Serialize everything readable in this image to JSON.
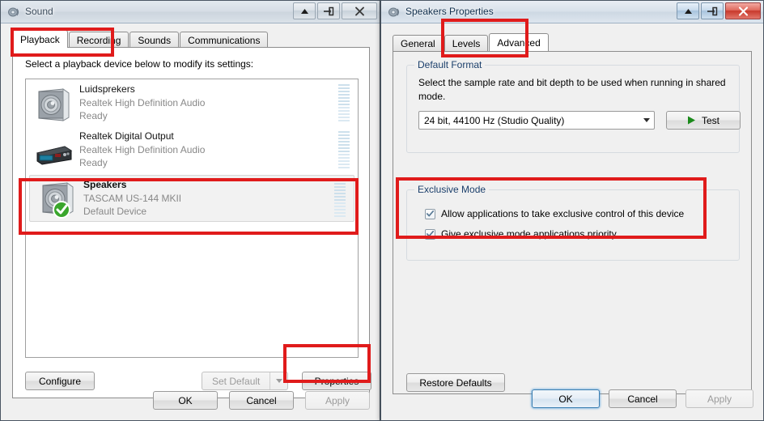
{
  "backdrop": {
    "ghost_text": "exclusive mode"
  },
  "sound_window": {
    "title": "Sound",
    "icon": "speaker-icon",
    "window_buttons": [
      {
        "name": "minimize-button",
        "glyph": "up-arrow-icon"
      },
      {
        "name": "maximize-button",
        "glyph": "pin-icon"
      },
      {
        "name": "close-button",
        "glyph": "close-x-icon"
      }
    ],
    "tabs": [
      {
        "label": "Playback",
        "active": true
      },
      {
        "label": "Recording",
        "active": false
      },
      {
        "label": "Sounds",
        "active": false
      },
      {
        "label": "Communications",
        "active": false
      }
    ],
    "instruction": "Select a playback device below to modify its settings:",
    "devices": [
      {
        "name": "Luidsprekers",
        "driver": "Realtek High Definition Audio",
        "status": "Ready",
        "icon": "speaker-box-icon",
        "selected": false,
        "default": false
      },
      {
        "name": "Realtek Digital Output",
        "driver": "Realtek High Definition Audio",
        "status": "Ready",
        "icon": "digital-receiver-icon",
        "selected": false,
        "default": false
      },
      {
        "name": "Speakers",
        "driver": "TASCAM US-144 MKII",
        "status": "Default Device",
        "icon": "speaker-box-icon",
        "selected": true,
        "default": true
      }
    ],
    "buttons": {
      "configure": "Configure",
      "set_default": "Set Default",
      "properties": "Properties",
      "ok": "OK",
      "cancel": "Cancel",
      "apply": "Apply"
    }
  },
  "properties_window": {
    "title": "Speakers Properties",
    "icon": "speaker-icon",
    "window_buttons": [
      {
        "name": "minimize-button",
        "glyph": "up-arrow-icon"
      },
      {
        "name": "maximize-button",
        "glyph": "pin-icon"
      },
      {
        "name": "close-button",
        "glyph": "close-x-icon"
      }
    ],
    "tabs": [
      {
        "label": "General",
        "active": false
      },
      {
        "label": "Levels",
        "active": false
      },
      {
        "label": "Advanced",
        "active": true
      }
    ],
    "default_format": {
      "legend": "Default Format",
      "description": "Select the sample rate and bit depth to be used when running in shared mode.",
      "selected_value": "24 bit, 44100 Hz (Studio Quality)",
      "test_label": "Test"
    },
    "exclusive_mode": {
      "legend": "Exclusive Mode",
      "checkboxes": [
        {
          "label": "Allow applications to take exclusive control of this device",
          "checked": true
        },
        {
          "label": "Give exclusive mode applications priority",
          "checked": true
        }
      ]
    },
    "buttons": {
      "restore_defaults": "Restore Defaults",
      "ok": "OK",
      "cancel": "Cancel",
      "apply": "Apply"
    }
  },
  "annotations": {
    "color": "#e01b1b",
    "boxes": [
      "playback-recording-tabs",
      "speakers-device-row",
      "properties-button",
      "advanced-tab",
      "exclusive-mode-checkboxes"
    ]
  }
}
